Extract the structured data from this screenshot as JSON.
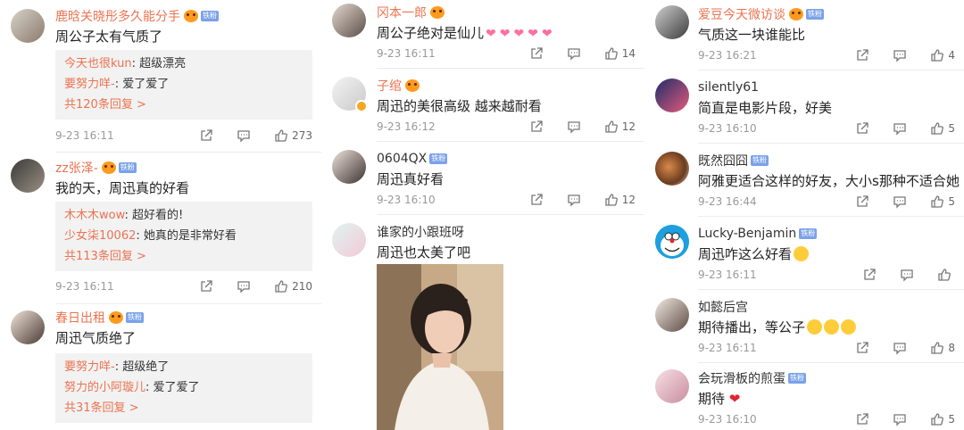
{
  "c1": [
    {
      "user": "鹿晗关晓彤多久能分手",
      "text": "周公子太有气质了",
      "replies": [
        {
          "user": "今天也很kun",
          "text": "超级漂亮"
        },
        {
          "user": "要努力咩-",
          "text": "爱了爱了"
        }
      ],
      "more": "共120条回复 >",
      "time": "9-23 16:11",
      "likes": "273"
    },
    {
      "user": "zz张泽-",
      "text": "我的天，周迅真的好看",
      "replies": [
        {
          "user": "木木木wow",
          "text": "超好看的!"
        },
        {
          "user": "少女柒10062",
          "text": "她真的是非常好看"
        }
      ],
      "more": "共113条回复 >",
      "time": "9-23 16:11",
      "likes": "210"
    },
    {
      "user": "春日出租",
      "text": "周迅气质绝了",
      "replies": [
        {
          "user": "要努力咩-",
          "text": "超级绝了"
        },
        {
          "user": "努力的小阿璇儿",
          "text": "爱了爱了"
        }
      ],
      "more": "共31条回复 >"
    }
  ],
  "c2": [
    {
      "user": "冈本一郎",
      "text": "周公子绝对是仙儿",
      "time": "9-23 16:11",
      "likes": "14"
    },
    {
      "user": "子绾",
      "text": "周迅的美很高级 越来越耐看",
      "time": "9-23 16:12",
      "likes": "12"
    },
    {
      "user": "0604QX",
      "text": "周迅真好看",
      "time": "9-23 16:10",
      "likes": "12"
    },
    {
      "user": "谁家的小跟班呀",
      "text": "周迅也太美了吧"
    }
  ],
  "c3": [
    {
      "user": "爱豆今天微访谈",
      "text": "气质这一块谁能比",
      "time": "9-23 16:21",
      "likes": "4"
    },
    {
      "user": "silently61",
      "text": "简直是电影片段，好美",
      "time": "9-23 16:10",
      "likes": "5"
    },
    {
      "user": "既然囧囧",
      "text": "阿雅更适合这样的好友，大小s那种不适合她",
      "time": "9-23 16:44",
      "likes": "5"
    },
    {
      "user": "Lucky-Benjamin",
      "text": "周迅咋这么好看",
      "time": "9-23 16:11",
      "likes": ""
    },
    {
      "user": "如懿后宫",
      "text": "期待播出，等公子",
      "time": "9-23 16:11",
      "likes": "8"
    },
    {
      "user": "会玩滑板的煎蛋",
      "text": "期待",
      "time": "9-23 16:10",
      "likes": "5"
    }
  ],
  "fan_badge": "铁粉",
  "colors": {
    "accent": "#eb7350",
    "meta": "#999999",
    "reply_bg": "#f2f2f2"
  },
  "icons": [
    "share-icon",
    "comment-icon",
    "like-icon"
  ]
}
